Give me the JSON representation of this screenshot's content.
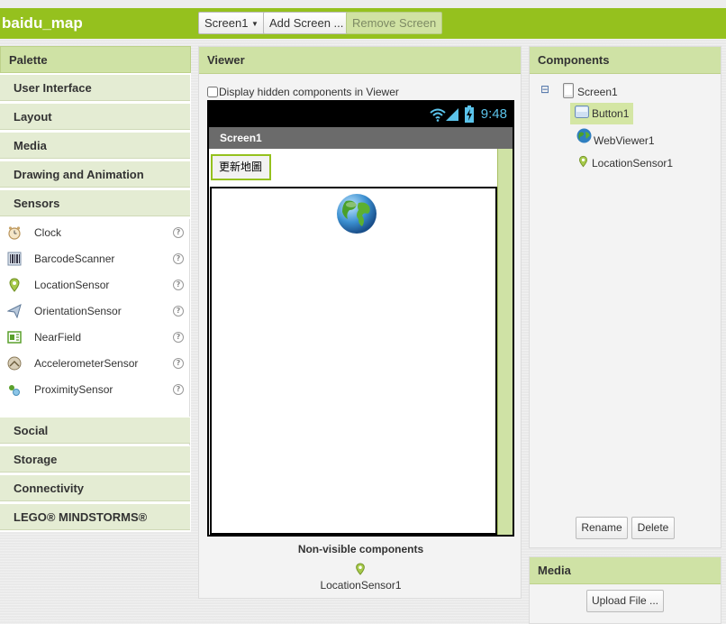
{
  "project": {
    "name": "baidu_map"
  },
  "toolbar": {
    "screen_select": "Screen1",
    "add_screen": "Add Screen ...",
    "remove_screen": "Remove Screen"
  },
  "palette": {
    "title": "Palette",
    "categories": [
      "User Interface",
      "Layout",
      "Media",
      "Drawing and Animation",
      "Sensors",
      "Social",
      "Storage",
      "Connectivity",
      "LEGO® MINDSTORMS®"
    ],
    "sensor_items": [
      {
        "label": "Clock",
        "icon": "clock-icon"
      },
      {
        "label": "BarcodeScanner",
        "icon": "barcode-icon"
      },
      {
        "label": "LocationSensor",
        "icon": "location-pin-icon"
      },
      {
        "label": "OrientationSensor",
        "icon": "orientation-icon"
      },
      {
        "label": "NearField",
        "icon": "nfc-icon"
      },
      {
        "label": "AccelerometerSensor",
        "icon": "accelerometer-icon"
      },
      {
        "label": "ProximitySensor",
        "icon": "proximity-icon"
      }
    ],
    "help_glyph": "?"
  },
  "viewer": {
    "title": "Viewer",
    "hidden_checkbox_label": "Display hidden components in Viewer",
    "status_time": "9:48",
    "screen_title": "Screen1",
    "button_text": "更新地圖",
    "nonvisible_title": "Non-visible components",
    "nonvisible_items": [
      "LocationSensor1"
    ]
  },
  "components": {
    "title": "Components",
    "collapse_glyph": "⊟",
    "tree": [
      {
        "label": "Screen1",
        "icon": "screen-icon"
      },
      {
        "label": "Button1",
        "icon": "button-icon",
        "selected": true
      },
      {
        "label": "WebViewer1",
        "icon": "globe-icon"
      },
      {
        "label": "LocationSensor1",
        "icon": "location-pin-icon"
      }
    ],
    "rename_label": "Rename",
    "delete_label": "Delete"
  },
  "media": {
    "title": "Media",
    "upload_label": "Upload File ..."
  },
  "colors": {
    "accent": "#95c11e",
    "header": "#cfe2a5",
    "status_time": "#5bc3ea"
  }
}
